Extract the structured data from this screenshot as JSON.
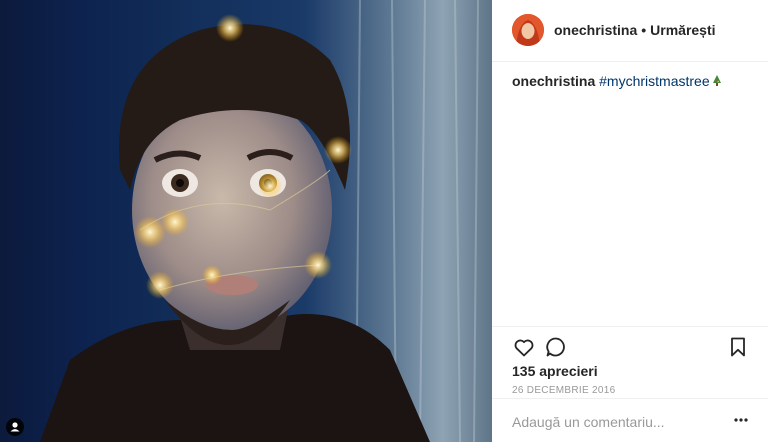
{
  "header": {
    "username": "onechristina",
    "separator": "•",
    "follow_label": "Urmărești"
  },
  "caption": {
    "username": "onechristina",
    "hashtag": "#mychristmastree"
  },
  "likes_text": "135 aprecieri",
  "date_text": "26 DECEMBRIE 2016",
  "comment_input": {
    "placeholder": "Adaugă un comentariu..."
  },
  "icons": {
    "like": "heart-icon",
    "comment": "comment-bubble-icon",
    "save": "bookmark-icon",
    "more": "more-options-icon",
    "tagged_people": "user-tag-icon",
    "caption_emoji": "christmas-tree-icon"
  },
  "colors": {
    "hashtag": "#003569",
    "secondary_text": "#999999",
    "primary_text": "#262626",
    "divider": "#efefef"
  }
}
